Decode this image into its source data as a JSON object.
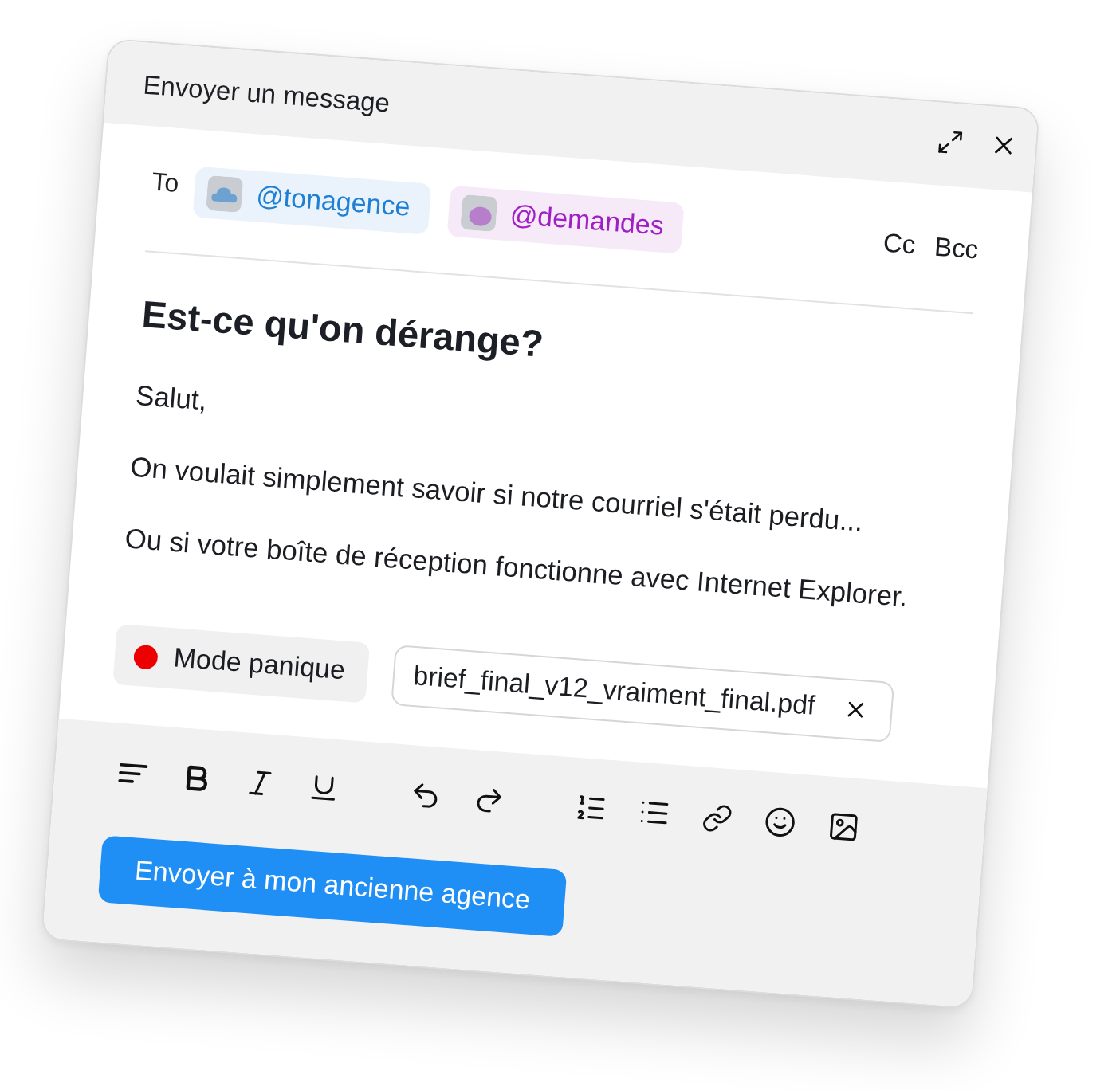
{
  "window": {
    "title": "Envoyer un message"
  },
  "recipients": {
    "label": "To",
    "chips": [
      {
        "handle": "@tonagence",
        "color": "#1f7fd4"
      },
      {
        "handle": "@demandes",
        "color": "#a01fc4"
      }
    ],
    "cc": "Cc",
    "bcc": "Bcc"
  },
  "message": {
    "subject": "Est-ce qu'on dérange?",
    "paragraphs": [
      "Salut,",
      "On voulait simplement savoir si notre courriel s'était perdu...",
      "Ou si votre boîte de réception fonctionne avec Internet Explorer."
    ]
  },
  "panic_mode": {
    "label": "Mode panique"
  },
  "attachment": {
    "filename": "brief_final_v12_vraiment_final.pdf"
  },
  "send_button": {
    "label": "Envoyer à mon ancienne agence"
  }
}
